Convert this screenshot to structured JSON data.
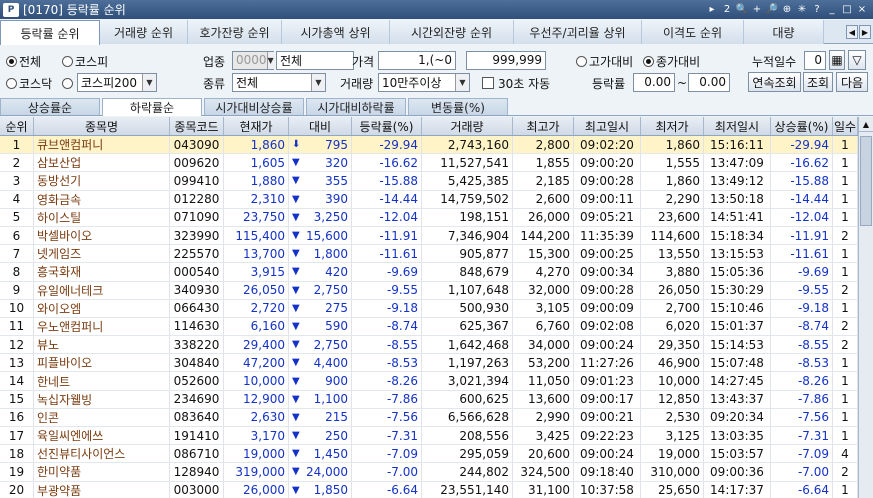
{
  "window": {
    "title": "[0170] 등락률 순위",
    "logo": "P"
  },
  "title_controls": [
    "▸",
    "2",
    "🔍",
    "+",
    "🔎",
    "⊕",
    "✳",
    "?",
    "_",
    "□",
    "×"
  ],
  "main_tabs": [
    "등락률 순위",
    "거래량 순위",
    "호가잔량 순위",
    "시가총액 상위",
    "시간외잔량 순위",
    "우선주/괴리율 상위",
    "이격도 순위",
    "대량"
  ],
  "filters": {
    "market_all": "전체",
    "market_kospi": "코스피",
    "market_kosdaq": "코스닥",
    "market_kospi200": "코스피",
    "kospi200_select": "코스피200",
    "industry_label": "업종",
    "industry_code": "0000",
    "industry_name": "전체",
    "kind_label": "종류",
    "kind_value": "전체",
    "price_label": "가격",
    "price_from": "1,(~0",
    "price_to": "999,999",
    "volume_label": "거래량",
    "volume_value": "10만주이상",
    "auto_label": "30초 자동",
    "high_compare": "고가대비",
    "close_compare": "종가대비",
    "rate_label": "등락률",
    "rate_from": "0.00",
    "rate_to": "0.00",
    "cum_days_label": "누적일수",
    "cum_days_value": "0",
    "btn_continuous": "연속조회",
    "btn_query": "조회",
    "btn_next": "다음"
  },
  "sub_tabs": [
    "상승률순",
    "하락률순",
    "시가대비상승률",
    "시가대비하락률",
    "변동률(%)"
  ],
  "columns": [
    "순위",
    "종목명",
    "종목코드",
    "현재가",
    "대비",
    "등락률(%)",
    "거래량",
    "최고가",
    "최고일시",
    "최저가",
    "최저일시",
    "상승률(%)",
    "일수"
  ],
  "rows": [
    [
      "1",
      "큐브앤컴퍼니",
      "043090",
      "1,860",
      "795",
      "-29.94",
      "2,743,160",
      "2,800",
      "09:02:20",
      "1,860",
      "15:16:11",
      "-29.94",
      "1"
    ],
    [
      "2",
      "삼보산업",
      "009620",
      "1,605",
      "320",
      "-16.62",
      "11,527,541",
      "1,855",
      "09:00:20",
      "1,555",
      "13:47:09",
      "-16.62",
      "1"
    ],
    [
      "3",
      "동방선기",
      "099410",
      "1,880",
      "355",
      "-15.88",
      "5,425,385",
      "2,185",
      "09:00:28",
      "1,860",
      "13:49:12",
      "-15.88",
      "1"
    ],
    [
      "4",
      "영화금속",
      "012280",
      "2,310",
      "390",
      "-14.44",
      "14,759,502",
      "2,600",
      "09:00:11",
      "2,290",
      "13:50:18",
      "-14.44",
      "1"
    ],
    [
      "5",
      "하이스틸",
      "071090",
      "23,750",
      "3,250",
      "-12.04",
      "198,151",
      "26,000",
      "09:05:21",
      "23,600",
      "14:51:41",
      "-12.04",
      "1"
    ],
    [
      "6",
      "박셀바이오",
      "323990",
      "115,400",
      "15,600",
      "-11.91",
      "7,346,904",
      "144,200",
      "11:35:39",
      "114,600",
      "15:18:34",
      "-11.91",
      "2"
    ],
    [
      "7",
      "넷게임즈",
      "225570",
      "13,700",
      "1,800",
      "-11.61",
      "905,877",
      "15,300",
      "09:00:25",
      "13,550",
      "13:15:53",
      "-11.61",
      "1"
    ],
    [
      "8",
      "흥국화재",
      "000540",
      "3,915",
      "420",
      "-9.69",
      "848,679",
      "4,270",
      "09:00:34",
      "3,880",
      "15:05:36",
      "-9.69",
      "1"
    ],
    [
      "9",
      "유일에너테크",
      "340930",
      "26,050",
      "2,750",
      "-9.55",
      "1,107,648",
      "32,000",
      "09:00:28",
      "26,050",
      "15:30:29",
      "-9.55",
      "2"
    ],
    [
      "10",
      "와이오엠",
      "066430",
      "2,720",
      "275",
      "-9.18",
      "500,930",
      "3,105",
      "09:00:09",
      "2,700",
      "15:10:46",
      "-9.18",
      "1"
    ],
    [
      "11",
      "우노앤컴퍼니",
      "114630",
      "6,160",
      "590",
      "-8.74",
      "625,367",
      "6,760",
      "09:02:08",
      "6,020",
      "15:01:37",
      "-8.74",
      "2"
    ],
    [
      "12",
      "뷰노",
      "338220",
      "29,400",
      "2,750",
      "-8.55",
      "1,642,468",
      "34,000",
      "09:00:24",
      "29,350",
      "15:14:53",
      "-8.55",
      "2"
    ],
    [
      "13",
      "피플바이오",
      "304840",
      "47,200",
      "4,400",
      "-8.53",
      "1,197,263",
      "53,200",
      "11:27:26",
      "46,900",
      "15:07:48",
      "-8.53",
      "1"
    ],
    [
      "14",
      "한네트",
      "052600",
      "10,000",
      "900",
      "-8.26",
      "3,021,394",
      "11,050",
      "09:01:23",
      "10,000",
      "14:27:45",
      "-8.26",
      "1"
    ],
    [
      "15",
      "녹십자웰빙",
      "234690",
      "12,900",
      "1,100",
      "-7.86",
      "600,625",
      "13,600",
      "09:00:17",
      "12,850",
      "13:43:37",
      "-7.86",
      "1"
    ],
    [
      "16",
      "인콘",
      "083640",
      "2,630",
      "215",
      "-7.56",
      "6,566,628",
      "2,990",
      "09:00:21",
      "2,530",
      "09:20:34",
      "-7.56",
      "1"
    ],
    [
      "17",
      "육일씨엔에쓰",
      "191410",
      "3,170",
      "250",
      "-7.31",
      "208,556",
      "3,425",
      "09:22:23",
      "3,125",
      "13:03:35",
      "-7.31",
      "1"
    ],
    [
      "18",
      "선진뷰티사이언스",
      "086710",
      "19,000",
      "1,450",
      "-7.09",
      "295,059",
      "20,600",
      "09:00:24",
      "19,000",
      "15:03:57",
      "-7.09",
      "4"
    ],
    [
      "19",
      "한미약품",
      "128940",
      "319,000",
      "24,000",
      "-7.00",
      "244,802",
      "324,500",
      "09:18:40",
      "310,000",
      "09:00:36",
      "-7.00",
      "2"
    ],
    [
      "20",
      "부광약품",
      "003000",
      "26,000",
      "1,850",
      "-6.64",
      "23,551,140",
      "31,100",
      "10:37:58",
      "25,650",
      "14:17:37",
      "-6.64",
      "1"
    ]
  ],
  "colors": {
    "down": "#1432c8",
    "name": "#7a3b10",
    "selected_row": "#fff3c8"
  }
}
